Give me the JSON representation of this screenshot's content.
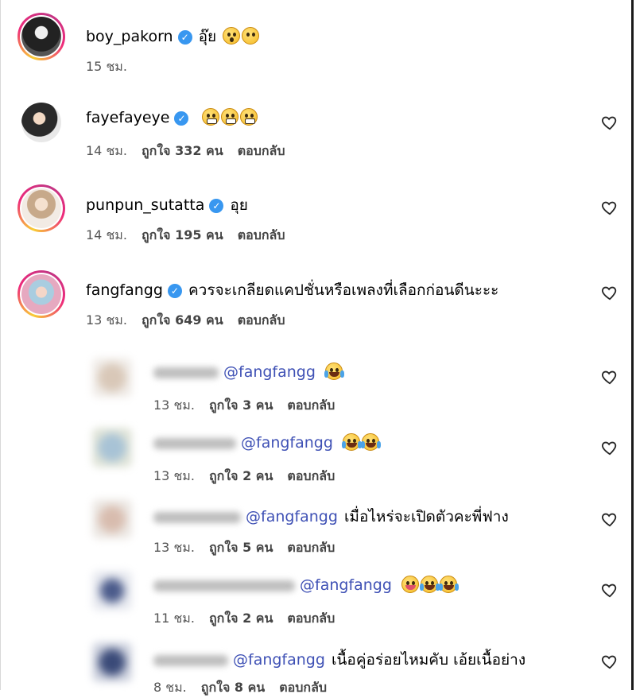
{
  "comments": [
    {
      "username": "boy_pakorn",
      "text": "อุ๊ย",
      "time": "15 ชม.",
      "likes": "",
      "reply": ""
    },
    {
      "username": "fayefayeye",
      "text": "",
      "time": "14 ชม.",
      "likes": "ถูกใจ 332 คน",
      "reply": "ตอบกลับ"
    },
    {
      "username": "punpun_sutatta",
      "text": "อุย",
      "time": "14 ชม.",
      "likes": "ถูกใจ 195 คน",
      "reply": "ตอบกลับ"
    },
    {
      "username": "fangfangg",
      "text": "ควรจะเกลียดแคปชั่นหรือเพลงที่เลือกก่อนดีนะะะ",
      "time": "13 ชม.",
      "likes": "ถูกใจ 649 คน",
      "reply": "ตอบกลับ"
    }
  ],
  "replies": [
    {
      "mention": "@fangfangg",
      "text": "",
      "time": "13 ชม.",
      "likes": "ถูกใจ 3 คน",
      "reply": "ตอบกลับ"
    },
    {
      "mention": "@fangfangg",
      "text": "",
      "time": "13 ชม.",
      "likes": "ถูกใจ 2 คน",
      "reply": "ตอบกลับ"
    },
    {
      "mention": "@fangfangg",
      "text": "เมื่อไหร่จะเปิดตัวคะพี่ฟาง",
      "time": "13 ชม.",
      "likes": "ถูกใจ 5 คน",
      "reply": "ตอบกลับ"
    },
    {
      "mention": "@fangfangg",
      "text": "",
      "time": "11 ชม.",
      "likes": "ถูกใจ 2 คน",
      "reply": "ตอบกลับ"
    },
    {
      "mention": "@fangfangg",
      "text": "เนื้อคู่อร่อยไหมคับ เอ้ยเนื้อย่าง",
      "time": "8 ชม.",
      "likes": "ถูกใจ 8 คน",
      "reply": "ตอบกลับ"
    }
  ],
  "colors": {
    "mention": "#3f51b5",
    "verified": "#3897f0",
    "meta": "#555555"
  }
}
